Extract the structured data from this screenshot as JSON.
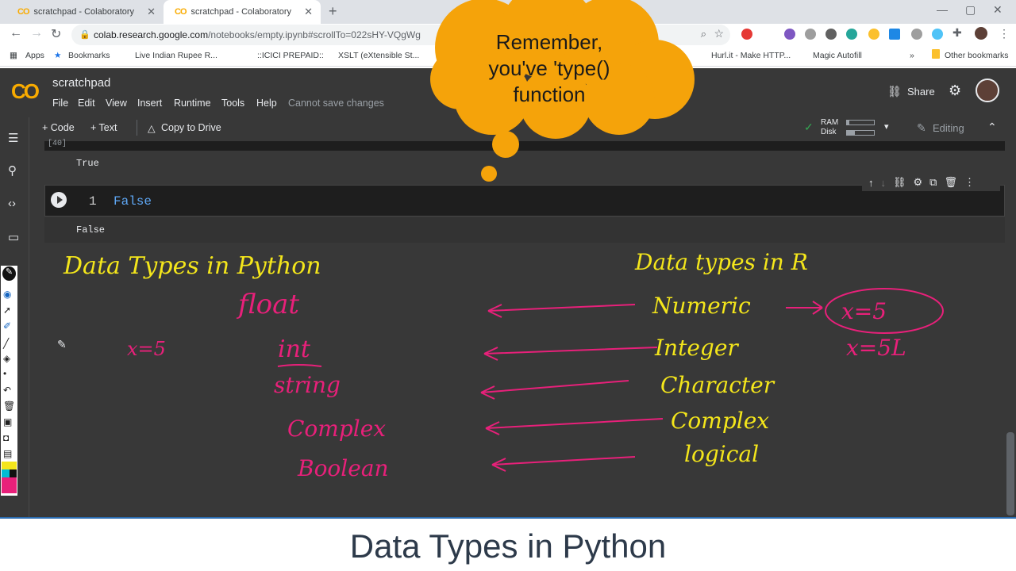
{
  "browser": {
    "tabs": [
      {
        "title": "scratchpad - Colaboratory"
      },
      {
        "title": "scratchpad - Colaboratory"
      }
    ],
    "url_host": "colab.research.google.com",
    "url_path": "/notebooks/empty.ipynb#scrollTo=022sHY-VQgWg",
    "bookmarks": [
      "Apps",
      "Bookmarks",
      "Live Indian Rupee R...",
      "::ICICI PREPAID::",
      "XSLT (eXtensible St...",
      "Hurl.it - Make HTTP...",
      "Magic Autofill",
      "»",
      "Other bookmarks"
    ]
  },
  "colab": {
    "logo": "CO",
    "notebook_title": "scratchpad",
    "menu": [
      "File",
      "Edit",
      "View",
      "Insert",
      "Runtime",
      "Tools",
      "Help"
    ],
    "save_status": "Cannot save changes",
    "share_label": "Share",
    "add_code": "+ Code",
    "add_text": "+ Text",
    "copy_to_drive": "Copy to Drive",
    "ram_label": "RAM",
    "disk_label": "Disk",
    "ram_usage": 0.1,
    "disk_usage": 0.3,
    "editing_label": "Editing",
    "prev_exec": "[40]"
  },
  "cells": {
    "output_true": "True",
    "line_number": "1",
    "code": "False",
    "output_false": "False"
  },
  "bubble": {
    "line1": "Remember,",
    "line2": "you've 'type()",
    "line3": "function"
  },
  "ink": {
    "python_header": "Data   Types in Python",
    "r_header": "Data  types  in  R",
    "python_types": [
      "float",
      "int",
      "string",
      "Complex",
      "Boolean"
    ],
    "r_types": [
      "Numeric",
      "Integer",
      "Character",
      "Complex",
      "logical"
    ],
    "example_left": "x=5",
    "example_r1": "x=5",
    "example_r2": "x=5L"
  },
  "caption": "Data Types in Python",
  "colors": {
    "accent": "#f9ab00",
    "ink_yellow": "#f4e61b",
    "ink_pink": "#e8207a",
    "bubble": "#f5a30a"
  }
}
